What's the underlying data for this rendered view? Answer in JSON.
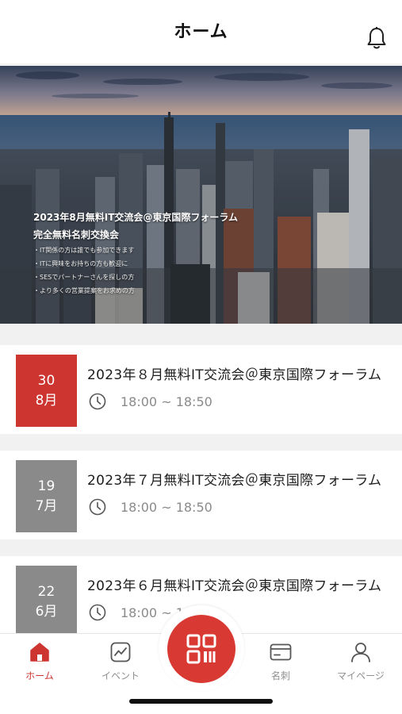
{
  "header": {
    "title": "ホーム"
  },
  "banner": {
    "title_line1": "2023年8月無料IT交流会@東京国際フォーラム",
    "title_line2": "完全無料名刺交換会",
    "bullets": [
      "・IT関係の方は誰でも参加できます",
      "・ITに興味をお持ちの方も歓迎に",
      "・SESでパートナーさんを探しの方",
      "・より多くの営業提案をお求めの方"
    ]
  },
  "events": [
    {
      "day": "30",
      "month": "8月",
      "title": "2023年８月無料IT交流会＠東京国際フォーラム",
      "time": "18:00 ~ 18:50",
      "status": "active"
    },
    {
      "day": "19",
      "month": "7月",
      "title": "2023年７月無料IT交流会＠東京国際フォーラム",
      "time": "18:00 ~ 18:50",
      "status": "past"
    },
    {
      "day": "22",
      "month": "6月",
      "title": "2023年６月無料IT交流会＠東京国際フォーラム",
      "time": "18:00 ~ 18:50",
      "status": "past"
    }
  ],
  "nav": {
    "home": "ホーム",
    "event": "イベント",
    "card": "名刺",
    "mypage": "マイページ"
  },
  "colors": {
    "accent": "#cd3530",
    "past": "#8a8a8a"
  }
}
